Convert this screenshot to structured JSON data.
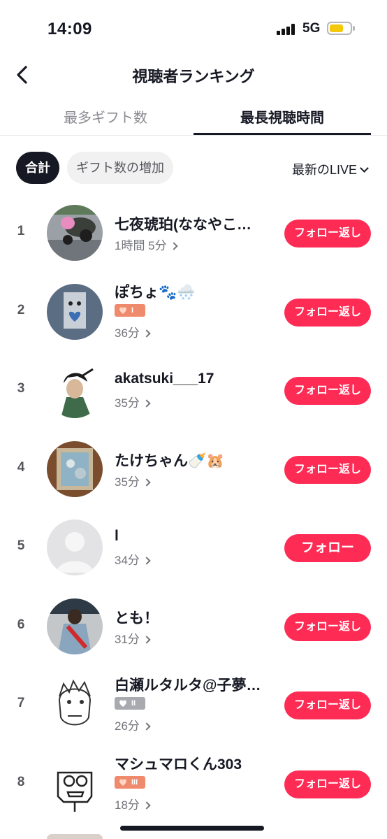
{
  "status": {
    "time": "14:09",
    "network": "5G"
  },
  "header": {
    "title": "視聴者ランキング"
  },
  "tabs": [
    {
      "label": "最多ギフト数",
      "active": false
    },
    {
      "label": "最長視聴時間",
      "active": true
    }
  ],
  "filters": {
    "total": "合計",
    "gift_increase": "ギフト数の増加",
    "sort": "最新のLIVE"
  },
  "viewers": [
    {
      "rank": "1",
      "name": "七夜琥珀(ななやこ…",
      "duration": "1時間 5分",
      "badge": "",
      "follow": "フォロー返し"
    },
    {
      "rank": "2",
      "name": "ぽちょ🐾🌨️",
      "duration": "36分",
      "badge": "I",
      "follow": "フォロー返し"
    },
    {
      "rank": "3",
      "name": "akatsuki___17",
      "duration": "35分",
      "badge": "",
      "follow": "フォロー返し"
    },
    {
      "rank": "4",
      "name": "たけちゃん🍼🐹",
      "duration": "35分",
      "badge": "",
      "follow": "フォロー返し"
    },
    {
      "rank": "5",
      "name": "l",
      "duration": "34分",
      "badge": "",
      "follow": "フォロー"
    },
    {
      "rank": "6",
      "name": "とも！",
      "duration": "31分",
      "badge": "",
      "follow": "フォロー返し"
    },
    {
      "rank": "7",
      "name": "白瀬ルタルタ@子夢…",
      "duration": "26分",
      "badge": "II",
      "follow": "フォロー返し"
    },
    {
      "rank": "8",
      "name": "マシュマロくん303",
      "duration": "18分",
      "badge": "III",
      "follow": "フォロー返し"
    }
  ],
  "colors": {
    "accent": "#fe2c55",
    "badge_orange": "#f08a6c",
    "badge_gray": "#a9aab0",
    "text": "#161823"
  }
}
